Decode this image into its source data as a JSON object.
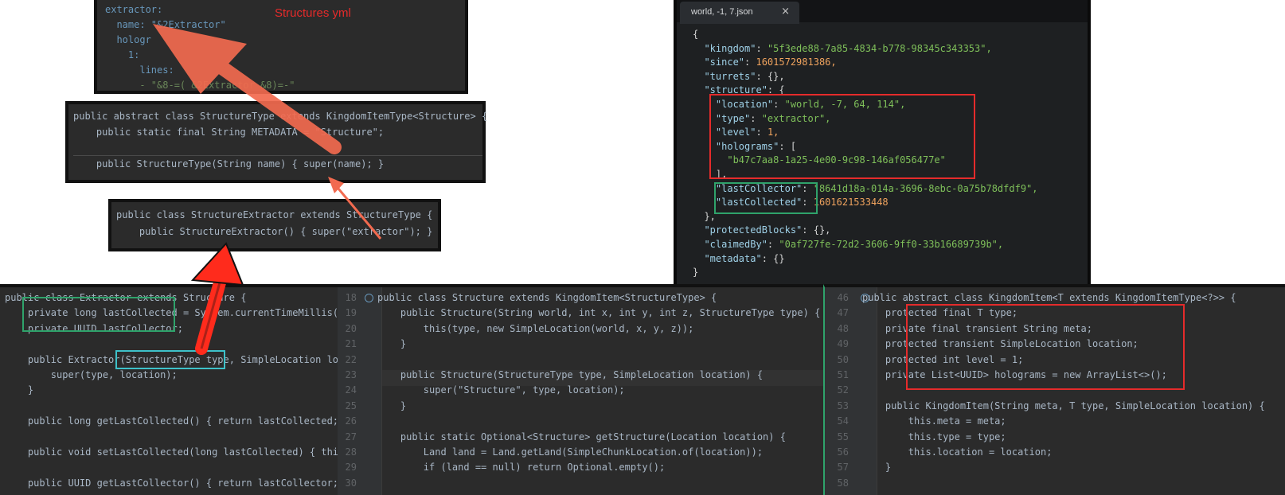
{
  "annotation": {
    "label": "Structures yml"
  },
  "yaml": {
    "lines": [
      "extractor:",
      "  name: \"&2Extractor\"",
      "  hologr",
      "    1:",
      "      lines:",
      "      - \"&8-=( &2Extractor &8)=-\""
    ]
  },
  "structure_type": {
    "lines": [
      "public abstract class StructureType extends KingdomItemType<Structure> {",
      "    public static final String METADATA = \"Structure\";",
      "",
      "    public StructureType(String name) { super(name); }"
    ]
  },
  "structure_extractor": {
    "lines": [
      "public class StructureExtractor extends StructureType {",
      "    public StructureExtractor() { super(\"extractor\"); }"
    ]
  },
  "json_editor": {
    "tab_title": "world, -1, 7.json",
    "close_symbol": "×",
    "lines": [
      "{",
      "  \"kingdom\": \"5f3ede88-7a85-4834-b778-98345c343353\",",
      "  \"since\": 1601572981386,",
      "  \"turrets\": {},",
      "  \"structure\": {",
      "    \"location\": \"world, -7, 64, 114\",",
      "    \"type\": \"extractor\",",
      "    \"level\": 1,",
      "    \"holograms\": [",
      "      \"b47c7aa8-1a25-4e00-9c98-146af056477e\"",
      "    ],",
      "    \"lastCollector\": \"8641d18a-014a-3696-8ebc-0a75b78dfdf9\",",
      "    \"lastCollected\": 1601621533448",
      "  },",
      "  \"protectedBlocks\": {},",
      "  \"claimedBy\": \"0af727fe-72d2-3606-9ff0-33b16689739b\",",
      "  \"metadata\": {}",
      "}"
    ]
  },
  "extractor_class": {
    "lines": [
      "public class Extractor extends Structure {",
      "    private long lastCollected = System.currentTimeMillis();",
      "    private UUID lastCollector;",
      "",
      "    public Extractor(StructureType type, SimpleLocation loca",
      "        super(type, location);",
      "    }",
      "",
      "    public long getLastCollected() { return lastCollected; }",
      "",
      "    public void setLastCollected(long lastCollected) { this.",
      "",
      "    public UUID getLastCollector() { return lastCollector; }"
    ]
  },
  "structure_class": {
    "line_numbers": [
      "18",
      "19",
      "20",
      "21",
      "22",
      "23",
      "24",
      "25",
      "26",
      "27",
      "28",
      "29",
      "30"
    ],
    "lines": [
      "public class Structure extends KingdomItem<StructureType> {",
      "    public Structure(String world, int x, int y, int z, StructureType type) {",
      "        this(type, new SimpleLocation(world, x, y, z));",
      "    }",
      "",
      "    public Structure(StructureType type, SimpleLocation location) {",
      "        super(\"Structure\", type, location);",
      "    }",
      "",
      "    public static Optional<Structure> getStructure(Location location) {",
      "        Land land = Land.getLand(SimpleChunkLocation.of(location));",
      "        if (land == null) return Optional.empty();",
      ""
    ]
  },
  "kingdom_item_class": {
    "line_numbers": [
      "46",
      "47",
      "48",
      "49",
      "50",
      "51",
      "52",
      "53",
      "54",
      "55",
      "56",
      "57",
      "58"
    ],
    "lines": [
      "public abstract class KingdomItem<T extends KingdomItemType<?>> {",
      "    protected final T type;",
      "    private final transient String meta;",
      "    protected transient SimpleLocation location;",
      "    protected int level = 1;",
      "    private List<UUID> holograms = new ArrayList<>();",
      "",
      "    public KingdomItem(String meta, T type, SimpleLocation location) {",
      "        this.meta = meta;",
      "        this.type = type;",
      "        this.location = location;",
      "    }",
      ""
    ]
  },
  "colors": {
    "red_box": "#e52b2b",
    "green_box": "#2fa36b",
    "teal_box": "#3ec1c9",
    "arrow": "#f26a4f"
  }
}
